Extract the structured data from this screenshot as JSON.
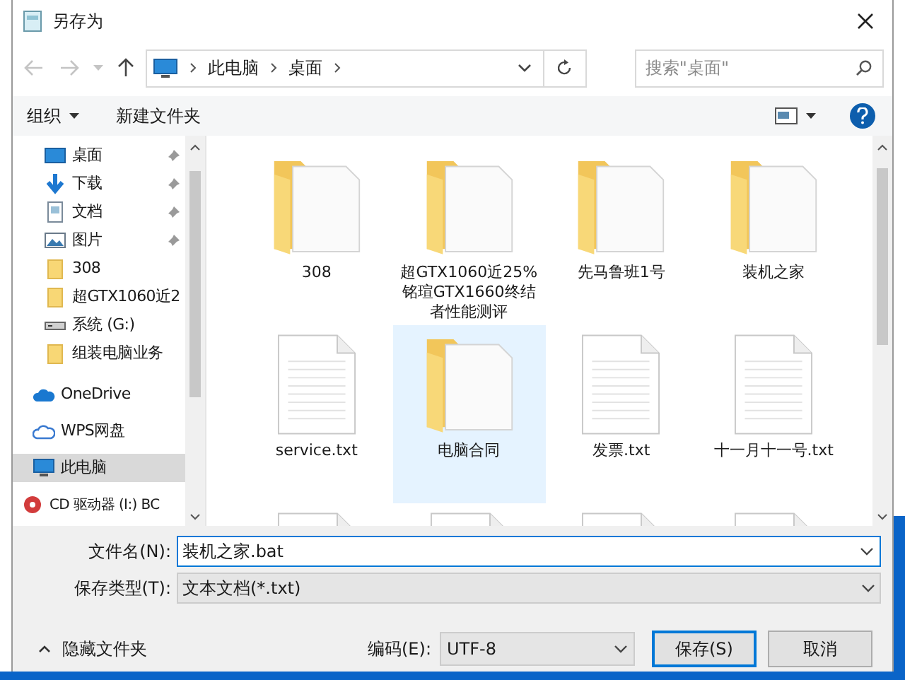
{
  "window": {
    "title": "另存为"
  },
  "address": {
    "crumbs": [
      "此电脑",
      "桌面"
    ]
  },
  "search": {
    "placeholder": "搜索\"桌面\""
  },
  "toolbar": {
    "organize": "组织",
    "new_folder": "新建文件夹"
  },
  "sidebar": {
    "items": [
      {
        "kind": "desktop",
        "label": "桌面",
        "pinned": true,
        "selected": false
      },
      {
        "kind": "download",
        "label": "下载",
        "pinned": true,
        "selected": false
      },
      {
        "kind": "document",
        "label": "文档",
        "pinned": true,
        "selected": false
      },
      {
        "kind": "picture",
        "label": "图片",
        "pinned": true,
        "selected": false
      },
      {
        "kind": "folder",
        "label": "308",
        "pinned": false,
        "selected": false
      },
      {
        "kind": "folder",
        "label": "超GTX1060近2",
        "pinned": false,
        "selected": false
      },
      {
        "kind": "drive",
        "label": "系统 (G:)",
        "pinned": false,
        "selected": false
      },
      {
        "kind": "folder",
        "label": "组装电脑业务",
        "pinned": false,
        "selected": false
      },
      {
        "kind": "cloud",
        "label": "OneDrive",
        "pinned": false,
        "selected": false
      },
      {
        "kind": "wps",
        "label": "WPS网盘",
        "pinned": false,
        "selected": false
      },
      {
        "kind": "pc",
        "label": "此电脑",
        "pinned": false,
        "selected": true
      },
      {
        "kind": "cd",
        "label": "CD 驱动器 (I:) BC",
        "pinned": false,
        "selected": false
      }
    ]
  },
  "files": [
    {
      "kind": "folder",
      "label": "308",
      "selected": false
    },
    {
      "kind": "folder",
      "label": "超GTX1060近25% 铭瑄GTX1660终结者性能测评",
      "selected": false
    },
    {
      "kind": "folder",
      "label": "先马鲁班1号",
      "selected": false
    },
    {
      "kind": "folder",
      "label": "装机之家",
      "selected": false
    },
    {
      "kind": "text",
      "label": "service.txt",
      "selected": false
    },
    {
      "kind": "folder",
      "label": "电脑合同",
      "selected": true
    },
    {
      "kind": "text",
      "label": "发票.txt",
      "selected": false
    },
    {
      "kind": "text",
      "label": "十一月十一号.txt",
      "selected": false
    },
    {
      "kind": "text",
      "selected": false
    },
    {
      "kind": "text",
      "selected": false
    },
    {
      "kind": "text",
      "selected": false
    },
    {
      "kind": "text",
      "selected": false
    }
  ],
  "form": {
    "filename_label": "文件名(N):",
    "filename": "装机之家.bat",
    "type_label": "保存类型(T):",
    "type": "文本文档(*.txt)",
    "hide_folders": "隐藏文件夹",
    "encoding_label": "编码(E):",
    "encoding": "UTF-8"
  },
  "buttons": [
    "保存(S)",
    "取消"
  ]
}
